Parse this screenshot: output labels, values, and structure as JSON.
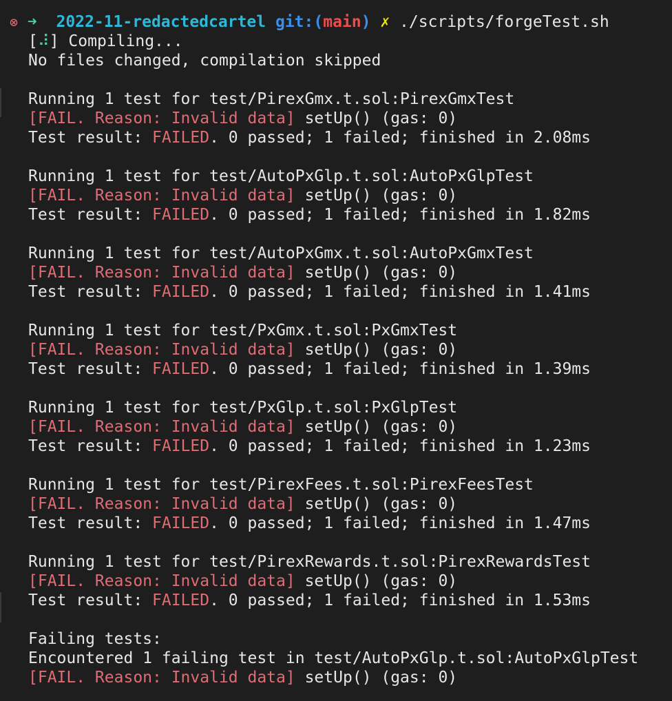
{
  "prompt": {
    "error_icon": "⊗",
    "arrow": "➜",
    "directory": "2022-11-redactedcartel",
    "git_label": "git:(",
    "branch": "main",
    "git_close": ")",
    "dirty_mark": "✗",
    "command": "./scripts/forgeTest.sh"
  },
  "compile": {
    "spinner_open": "[",
    "spinner_glyph": "⠼",
    "spinner_close": "] Compiling...",
    "status": "No files changed, compilation skipped"
  },
  "suites": [
    {
      "running": "Running 1 test for test/PirexGmx.t.sol:PirexGmxTest",
      "fail_label": "[FAIL. Reason: Invalid data]",
      "fail_rest": " setUp() (gas: 0)",
      "result_prefix": "Test result: ",
      "result_status": "FAILED",
      "result_rest": ". 0 passed; 1 failed; finished in 2.08ms"
    },
    {
      "running": "Running 1 test for test/AutoPxGlp.t.sol:AutoPxGlpTest",
      "fail_label": "[FAIL. Reason: Invalid data]",
      "fail_rest": " setUp() (gas: 0)",
      "result_prefix": "Test result: ",
      "result_status": "FAILED",
      "result_rest": ". 0 passed; 1 failed; finished in 1.82ms"
    },
    {
      "running": "Running 1 test for test/AutoPxGmx.t.sol:AutoPxGmxTest",
      "fail_label": "[FAIL. Reason: Invalid data]",
      "fail_rest": " setUp() (gas: 0)",
      "result_prefix": "Test result: ",
      "result_status": "FAILED",
      "result_rest": ". 0 passed; 1 failed; finished in 1.41ms"
    },
    {
      "running": "Running 1 test for test/PxGmx.t.sol:PxGmxTest",
      "fail_label": "[FAIL. Reason: Invalid data]",
      "fail_rest": " setUp() (gas: 0)",
      "result_prefix": "Test result: ",
      "result_status": "FAILED",
      "result_rest": ". 0 passed; 1 failed; finished in 1.39ms"
    },
    {
      "running": "Running 1 test for test/PxGlp.t.sol:PxGlpTest",
      "fail_label": "[FAIL. Reason: Invalid data]",
      "fail_rest": " setUp() (gas: 0)",
      "result_prefix": "Test result: ",
      "result_status": "FAILED",
      "result_rest": ". 0 passed; 1 failed; finished in 1.23ms"
    },
    {
      "running": "Running 1 test for test/PirexFees.t.sol:PirexFeesTest",
      "fail_label": "[FAIL. Reason: Invalid data]",
      "fail_rest": " setUp() (gas: 0)",
      "result_prefix": "Test result: ",
      "result_status": "FAILED",
      "result_rest": ". 0 passed; 1 failed; finished in 1.47ms"
    },
    {
      "running": "Running 1 test for test/PirexRewards.t.sol:PirexRewardsTest",
      "fail_label": "[FAIL. Reason: Invalid data]",
      "fail_rest": " setUp() (gas: 0)",
      "result_prefix": "Test result: ",
      "result_status": "FAILED",
      "result_rest": ". 0 passed; 1 failed; finished in 1.53ms"
    }
  ],
  "summary": {
    "heading": "Failing tests:",
    "encountered": "Encountered 1 failing test in test/AutoPxGlp.t.sol:AutoPxGlpTest",
    "fail_label": "[FAIL. Reason: Invalid data]",
    "fail_rest": " setUp() (gas: 0)"
  },
  "colors": {
    "background": "#1e1e1e",
    "foreground": "#e6e6e6",
    "error_red": "#e06c75",
    "directory_cyan": "#2eb8d8",
    "git_blue": "#3b8eea",
    "branch_red": "#f14c4c",
    "dirty_yellow": "#e5e510",
    "arrow_green": "#4ec9b0"
  }
}
